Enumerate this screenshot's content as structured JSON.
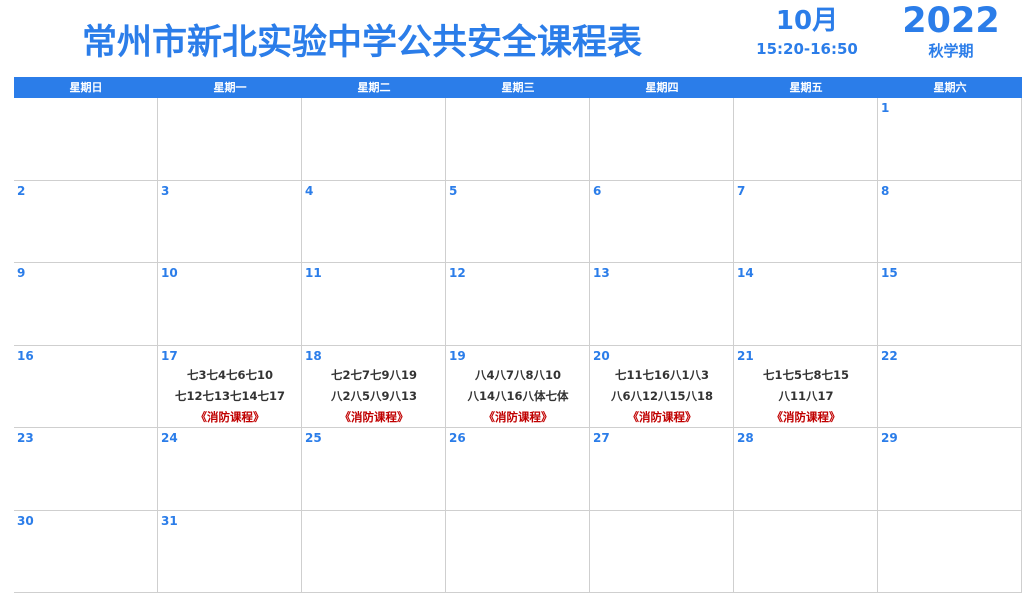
{
  "header": {
    "title": "常州市新北实验中学公共安全课程表",
    "month": "10月",
    "time": "15:20-16:50",
    "year": "2022",
    "term": "秋学期"
  },
  "weekdays": [
    "星期日",
    "星期一",
    "星期二",
    "星期三",
    "星期四",
    "星期五",
    "星期六"
  ],
  "weeks": [
    [
      {
        "day": ""
      },
      {
        "day": ""
      },
      {
        "day": ""
      },
      {
        "day": ""
      },
      {
        "day": ""
      },
      {
        "day": ""
      },
      {
        "day": "1"
      }
    ],
    [
      {
        "day": "2"
      },
      {
        "day": "3"
      },
      {
        "day": "4"
      },
      {
        "day": "5"
      },
      {
        "day": "6"
      },
      {
        "day": "7"
      },
      {
        "day": "8"
      }
    ],
    [
      {
        "day": "9"
      },
      {
        "day": "10"
      },
      {
        "day": "11"
      },
      {
        "day": "12"
      },
      {
        "day": "13"
      },
      {
        "day": "14"
      },
      {
        "day": "15"
      }
    ],
    [
      {
        "day": "16"
      },
      {
        "day": "17",
        "line1": "七3七4七6七10",
        "line2": "七12七13七14七17",
        "course": "《消防课程》"
      },
      {
        "day": "18",
        "line1": "七2七7七9八19",
        "line2": "八2八5八9八13",
        "course": "《消防课程》"
      },
      {
        "day": "19",
        "line1": "八4八7八8八10",
        "line2": "八14八16八体七体",
        "course": "《消防课程》"
      },
      {
        "day": "20",
        "line1": "七11七16八1八3",
        "line2": "八6八12八15八18",
        "course": "《消防课程》"
      },
      {
        "day": "21",
        "line1": "七1七5七8七15",
        "line2": "八11八17",
        "course": "《消防课程》"
      },
      {
        "day": "22"
      }
    ],
    [
      {
        "day": "23"
      },
      {
        "day": "24"
      },
      {
        "day": "25"
      },
      {
        "day": "26"
      },
      {
        "day": "27"
      },
      {
        "day": "28"
      },
      {
        "day": "29"
      }
    ],
    [
      {
        "day": "30"
      },
      {
        "day": "31"
      },
      {
        "day": ""
      },
      {
        "day": ""
      },
      {
        "day": ""
      },
      {
        "day": ""
      },
      {
        "day": ""
      }
    ]
  ]
}
